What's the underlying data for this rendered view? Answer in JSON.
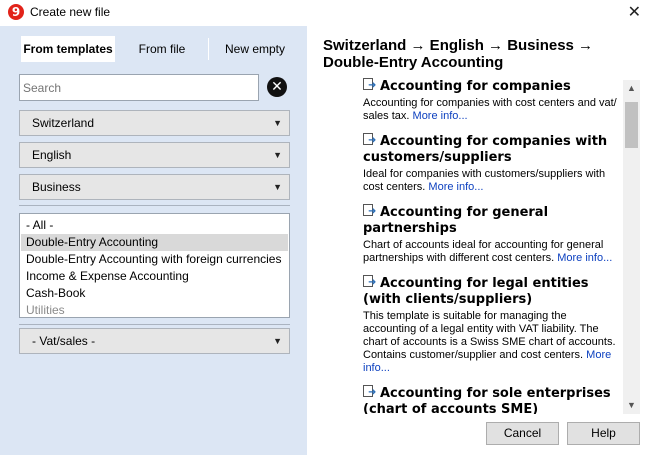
{
  "window": {
    "title": "Create new file",
    "app_icon_glyph": "9",
    "close_glyph": "✕"
  },
  "tabs": [
    {
      "label": "From templates",
      "active": true
    },
    {
      "label": "From file",
      "active": false
    },
    {
      "label": "New empty",
      "active": false
    }
  ],
  "search": {
    "value": "",
    "placeholder": "Search",
    "clear_glyph": "✕"
  },
  "filters": {
    "country": "Switzerland",
    "language": "English",
    "category": "Business",
    "vat": "- Vat/sales -",
    "caret_glyph": "▼"
  },
  "template_types": {
    "items": [
      {
        "label": "- All -"
      },
      {
        "label": "Double-Entry Accounting"
      },
      {
        "label": "Double-Entry Accounting with foreign currencies"
      },
      {
        "label": "Income & Expense Accounting"
      },
      {
        "label": "Cash-Book"
      },
      {
        "label": "Utilities"
      }
    ],
    "selected_index": 1,
    "disabled_index": 5
  },
  "breadcrumb": "Switzerland → English → Business → Double-Entry Accounting",
  "templates": [
    {
      "icon": "template-document-icon",
      "title": "Accounting for companies",
      "description": "Accounting for companies with cost centers and vat/ sales tax.",
      "more_link": "More info..."
    },
    {
      "icon": "template-document-icon",
      "title": "Accounting for companies with customers/suppliers",
      "description": "Ideal for companies with customers/suppliers with cost centers.",
      "more_link": "More info..."
    },
    {
      "icon": "template-document-icon",
      "title": "Accounting for general partnerships",
      "description": "Chart of accounts ideal for accounting for general partnerships with different cost centers.",
      "more_link": "More info..."
    },
    {
      "icon": "template-document-icon",
      "title": "Accounting for legal entities (with clients/suppliers)",
      "description": "This template is suitable for managing the accounting of a legal entity with VAT liability. The chart of accounts is a Swiss SME chart of accounts. Contains customer/supplier and cost centers.",
      "more_link": "More info..."
    },
    {
      "icon": "template-document-icon",
      "title": "Accounting for sole enterprises (chart of accounts SME)",
      "description": "",
      "more_link": ""
    }
  ],
  "scrollbar": {
    "up_glyph": "▲",
    "down_glyph": "▼"
  },
  "buttons": {
    "cancel": "Cancel",
    "help": "Help"
  },
  "colors": {
    "left_panel_bg": "#dce6f4",
    "link": "#0b3fbf",
    "app_icon": "#e2231a"
  }
}
